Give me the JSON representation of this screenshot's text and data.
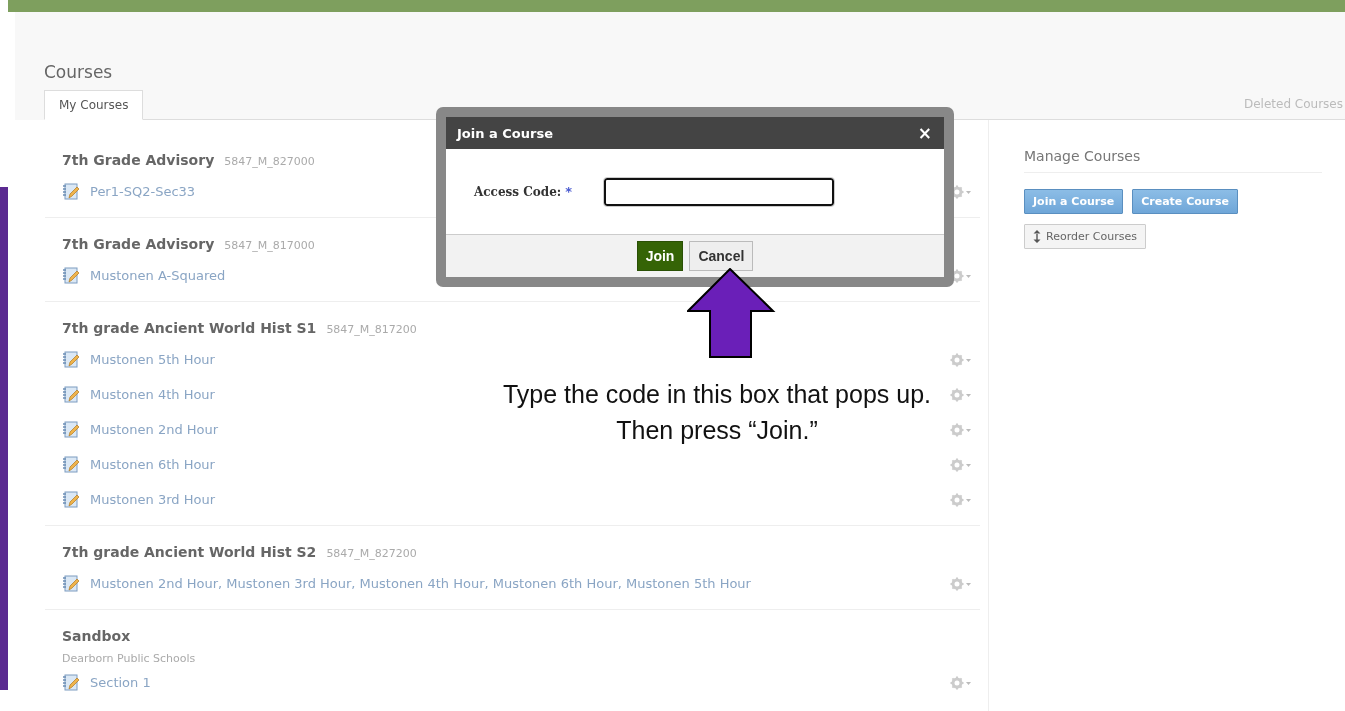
{
  "page_title": "Courses",
  "tabs": [
    {
      "label": "My Courses",
      "selected": true
    }
  ],
  "deleted_link": "Deleted Courses",
  "courses": [
    {
      "title": "7th Grade Advisory",
      "code": "5847_M_827000",
      "sections": [
        {
          "name": "Per1-SQ2-Sec33"
        }
      ]
    },
    {
      "title": "7th Grade Advisory",
      "code": "5847_M_817000",
      "sections": [
        {
          "name": "Mustonen A-Squared"
        }
      ]
    },
    {
      "title": "7th grade Ancient World Hist S1",
      "code": "5847_M_817200",
      "sections": [
        {
          "name": "Mustonen 5th Hour"
        },
        {
          "name": "Mustonen 4th Hour"
        },
        {
          "name": "Mustonen 2nd Hour"
        },
        {
          "name": "Mustonen 6th Hour"
        },
        {
          "name": "Mustonen 3rd Hour"
        }
      ]
    },
    {
      "title": "7th grade Ancient World Hist S2",
      "code": "5847_M_827200",
      "sections": [
        {
          "name": "Mustonen 2nd Hour, Mustonen 3rd Hour, Mustonen 4th Hour, Mustonen 6th Hour, Mustonen 5th Hour"
        }
      ]
    },
    {
      "title": "Sandbox",
      "subtitle": "Dearborn Public Schools",
      "sections": [
        {
          "name": "Section 1"
        }
      ]
    }
  ],
  "sidebar": {
    "title": "Manage Courses",
    "buttons": [
      {
        "label": "Join a Course",
        "kind": "primary"
      },
      {
        "label": "Create Course",
        "kind": "primary"
      },
      {
        "label": "Reorder Courses",
        "kind": "reorder"
      }
    ]
  },
  "dialog": {
    "title": "Join a Course",
    "close": "×",
    "field_label": "Access Code:",
    "required_mark": "*",
    "join": "Join",
    "cancel": "Cancel"
  },
  "annotation": "Type the code in this box that pops up. Then press “Join.”"
}
